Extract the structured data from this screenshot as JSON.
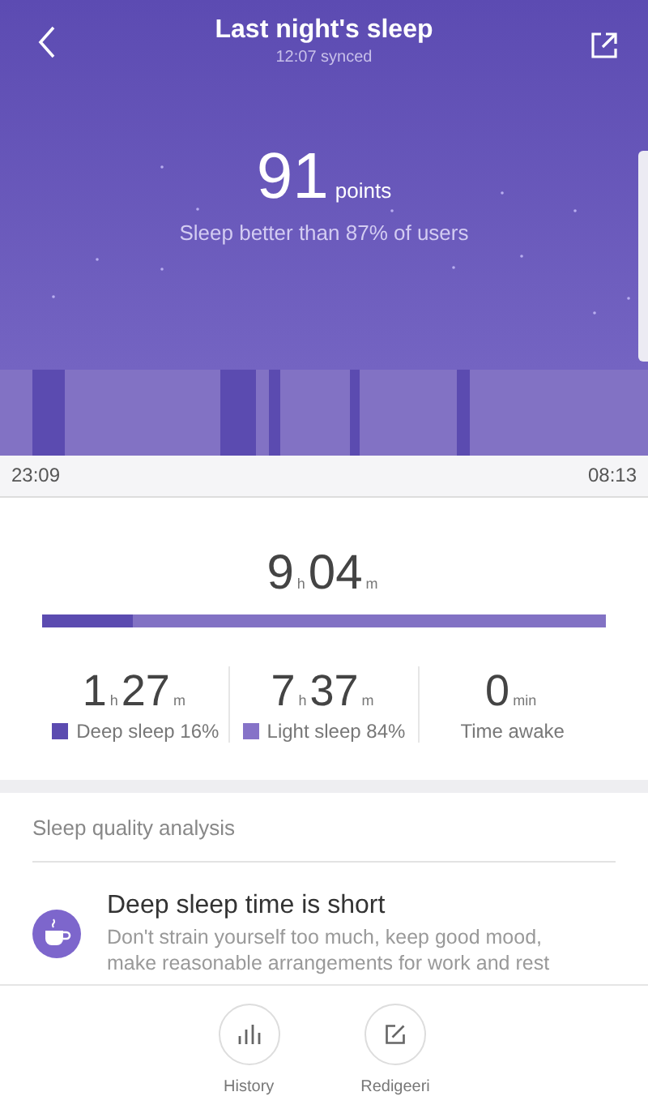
{
  "header": {
    "title": "Last night's sleep",
    "subtitle": "12:07 synced"
  },
  "score": {
    "value": "91",
    "unit": "points",
    "caption": "Sleep better than 87% of users"
  },
  "timeline": {
    "start": "23:09",
    "end": "08:13"
  },
  "total": {
    "hours": "9",
    "hours_unit": "h",
    "minutes": "04",
    "minutes_unit": "m",
    "deep_share": {
      "level": 0.16
    }
  },
  "stats": [
    {
      "kind": "hm",
      "hours": "1",
      "hours_unit": "h",
      "minutes": "27",
      "minutes_unit": "m",
      "label": "Deep sleep 16%",
      "color": "#5b4bb0"
    },
    {
      "kind": "hm",
      "hours": "7",
      "hours_unit": "h",
      "minutes": "37",
      "minutes_unit": "m",
      "label": "Light sleep 84%",
      "color": "#8673c8"
    },
    {
      "kind": "min",
      "value": "0",
      "unit": "min",
      "label": "Time awake"
    }
  ],
  "analysis": {
    "heading": "Sleep quality analysis",
    "title": "Deep sleep time is short",
    "text": "Don't strain yourself too much, keep good mood, make reasonable arrangements for work and rest"
  },
  "bottom_buttons": [
    {
      "kind": "history",
      "label": "History"
    },
    {
      "kind": "edit",
      "label": "Redigeeri"
    }
  ]
}
